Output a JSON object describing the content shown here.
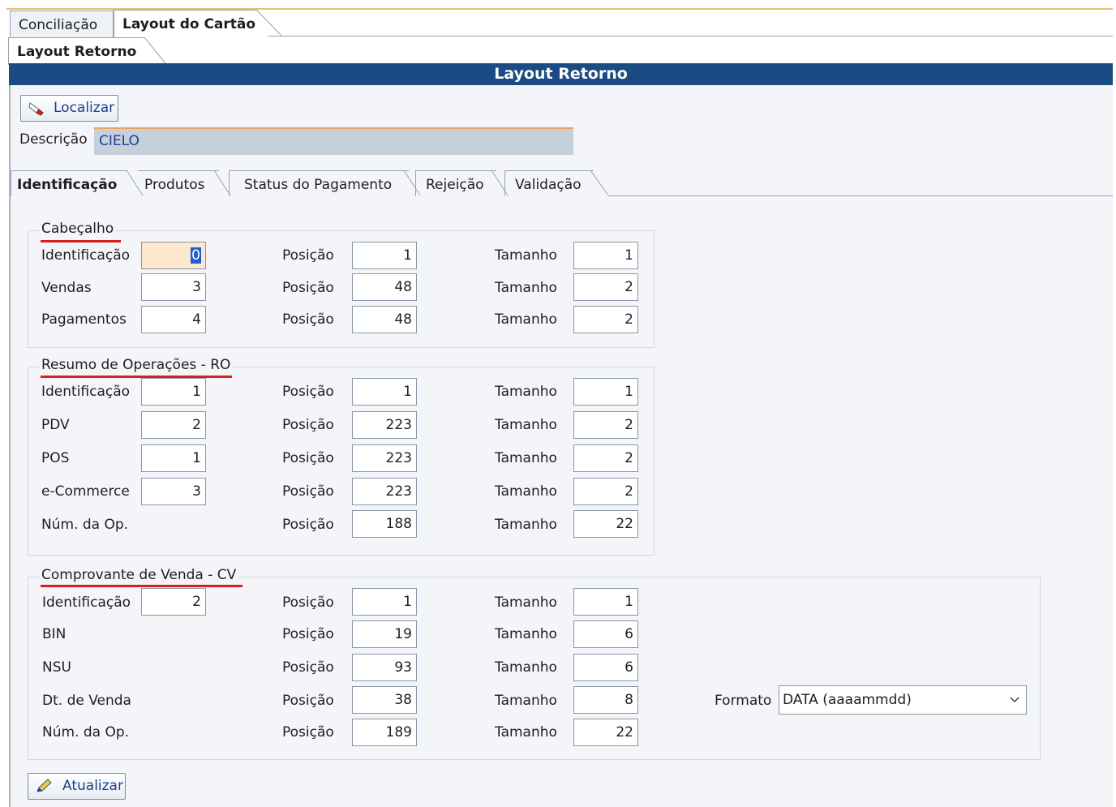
{
  "top_tabs": [
    "Conciliação",
    "Layout do Cartão"
  ],
  "sub_tab": "Layout Retorno",
  "title": "Layout Retorno",
  "localizar_label": "Localizar",
  "descricao": {
    "label": "Descrição",
    "value": "CIELO"
  },
  "inner_tabs": [
    "Identificação",
    "Produtos",
    "Status do Pagamento",
    "Rejeição",
    "Validação"
  ],
  "labels": {
    "posicao": "Posição",
    "tamanho": "Tamanho",
    "formato": "Formato"
  },
  "cabecalho": {
    "title": "Cabeçalho",
    "rows": [
      {
        "label": "Identificação",
        "value": "0",
        "posicao": "1",
        "tamanho": "1"
      },
      {
        "label": "Vendas",
        "value": "3",
        "posicao": "48",
        "tamanho": "2"
      },
      {
        "label": "Pagamentos",
        "value": "4",
        "posicao": "48",
        "tamanho": "2"
      }
    ]
  },
  "resumo": {
    "title": "Resumo de Operações - RO",
    "rows": [
      {
        "label": "Identificação",
        "value": "1",
        "posicao": "1",
        "tamanho": "1"
      },
      {
        "label": "PDV",
        "value": "2",
        "posicao": "223",
        "tamanho": "2"
      },
      {
        "label": "POS",
        "value": "1",
        "posicao": "223",
        "tamanho": "2"
      },
      {
        "label": "e-Commerce",
        "value": "3",
        "posicao": "223",
        "tamanho": "2"
      },
      {
        "label": "Núm. da Op.",
        "posicao": "188",
        "tamanho": "22"
      }
    ]
  },
  "comprovante": {
    "title": "Comprovante de Venda - CV",
    "rows": [
      {
        "label": "Identificação",
        "value": "2",
        "posicao": "1",
        "tamanho": "1"
      },
      {
        "label": "BIN",
        "posicao": "19",
        "tamanho": "6"
      },
      {
        "label": "NSU",
        "posicao": "93",
        "tamanho": "6"
      },
      {
        "label": "Dt. de Venda",
        "posicao": "38",
        "tamanho": "8"
      },
      {
        "label": "Núm. da Op.",
        "posicao": "189",
        "tamanho": "22"
      }
    ],
    "formato_value": "DATA (aaaammdd)"
  },
  "atualizar_label": "Atualizar",
  "icons": {
    "localizar": "eraser-icon",
    "atualizar": "pencil-icon",
    "dropdown": "chevron-down-icon"
  },
  "colors": {
    "title_bar": "#1a4b82",
    "legend_underline": "#d81e1e",
    "focus_field": "#fde8cf"
  }
}
